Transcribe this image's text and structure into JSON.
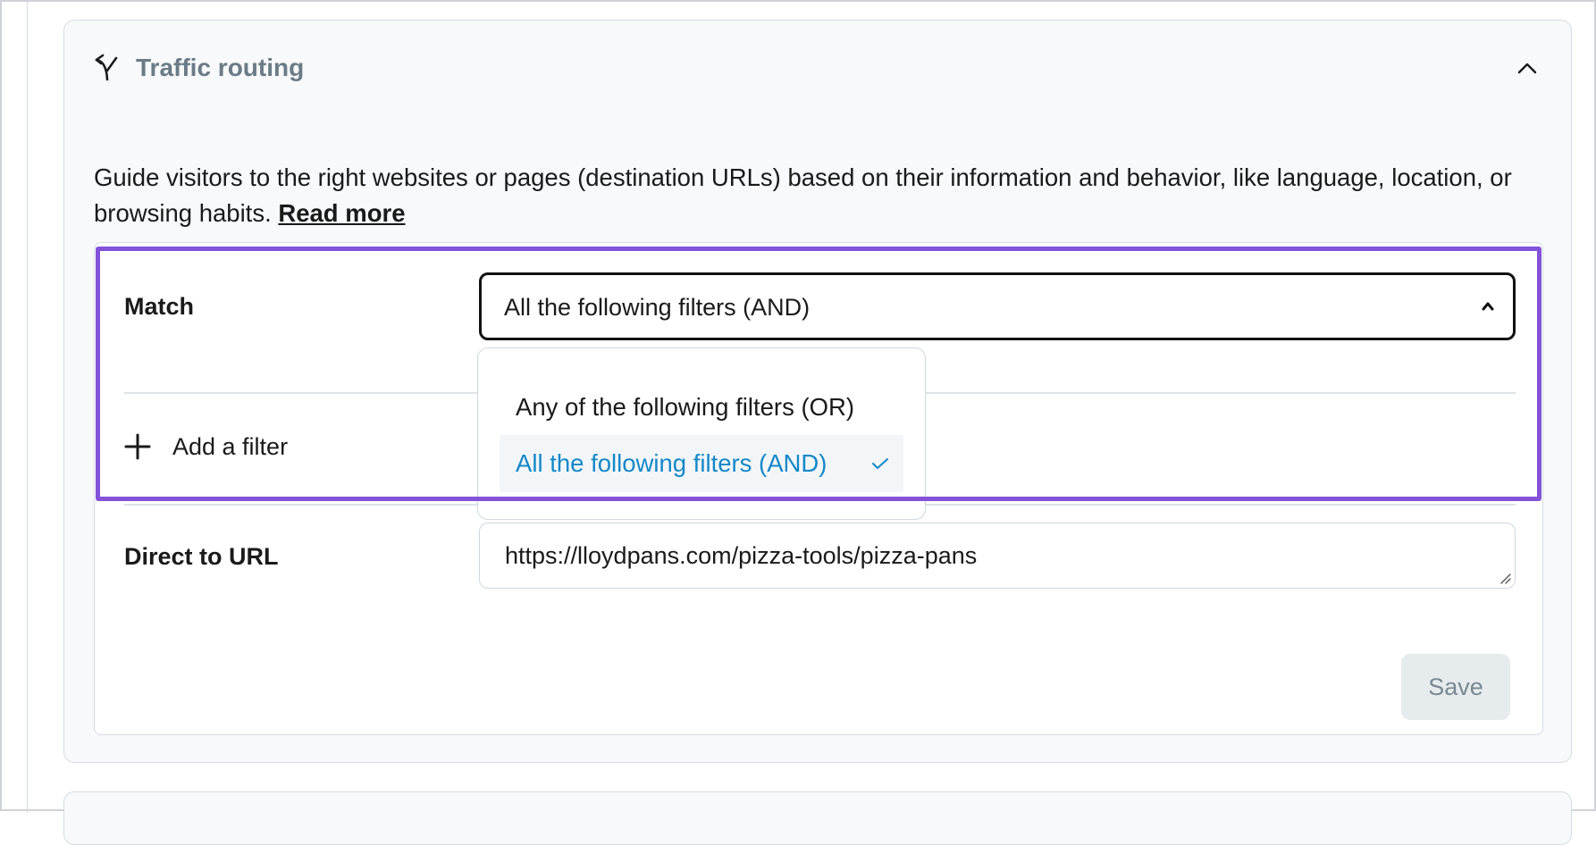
{
  "card": {
    "title": "Traffic routing",
    "header_icon": "split-route-icon",
    "collapse_icon": "chevron-up-icon"
  },
  "description": {
    "text": "Guide visitors to the right websites or pages (destination URLs) based on their information and behavior, like language, location, or browsing habits.",
    "link_label": "Read more"
  },
  "match": {
    "label": "Match",
    "selected": "All the following filters (AND)",
    "options": [
      {
        "label": "Any of the following filters (OR)",
        "selected": false
      },
      {
        "label": "All the following filters (AND)",
        "selected": true
      }
    ]
  },
  "filters": {
    "add_label": "Add a filter",
    "add_icon": "plus-icon"
  },
  "direct_url": {
    "label": "Direct to URL",
    "value": "https://lloydpans.com/pizza-tools/pizza-pans"
  },
  "actions": {
    "save_label": "Save"
  },
  "colors": {
    "accent_highlight": "#8352d9",
    "selected_option": "#1488c8",
    "muted_title": "#6b7b86"
  }
}
